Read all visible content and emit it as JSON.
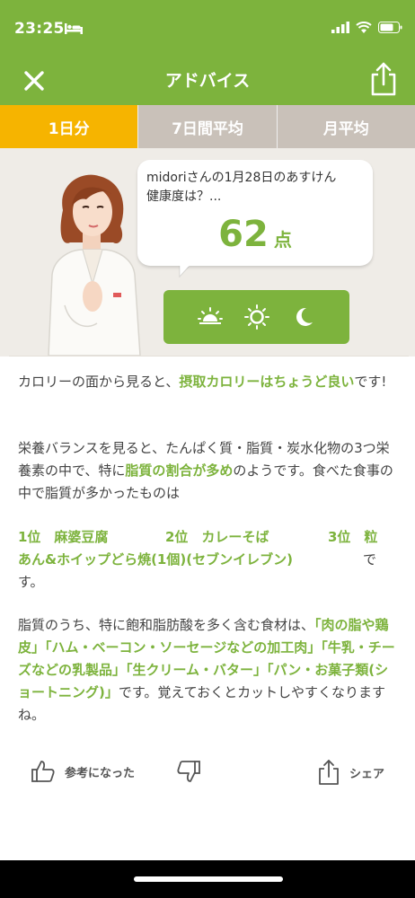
{
  "status": {
    "time": "23:25"
  },
  "nav": {
    "title": "アドバイス"
  },
  "tabs": [
    {
      "label": "1日分",
      "active": true
    },
    {
      "label": "7日間平均",
      "active": false
    },
    {
      "label": "月平均",
      "active": false
    }
  ],
  "bubble": {
    "text_line1": "midoriさんの1月28日のあすけん",
    "text_line2": "健康度は？...",
    "score": "62",
    "unit": "点"
  },
  "message": {
    "p1_a": "カロリーの面から見ると、",
    "p1_hl": "摂取カロリーはちょうど良い",
    "p1_b": "です!",
    "p2_a": "栄養バランスを見ると、たんぱく質・脂質・炭水化物の3つ栄養素の中で、特に",
    "p2_hl": "脂質の割合が多め",
    "p2_b": "のようです。食べた食事の中で脂質が多かったものは",
    "rank1": "1位　麻婆豆腐",
    "rank2": "2位　カレーそば",
    "rank3": "3位　粒",
    "rank_cont": "あん&ホイップどら焼(1個)(セブンイレブン)",
    "rank_tail_a": "で",
    "rank_tail_b": "す。",
    "p4_a": "脂質のうち、特に飽和脂肪酸を多く含む食材は、",
    "p4_hl": "「肉の脂や鶏皮」「ハム・ベーコン・ソーセージなどの加工肉」「牛乳・チーズなどの乳製品」「生クリーム・バター」「パン・お菓子類(ショートニング)」",
    "p4_b": "です。覚えておくとカットしやすくなりますね。"
  },
  "actions": {
    "helpful": "参考になった",
    "share": "シェア"
  },
  "colors": {
    "brand_green": "#7db33d",
    "tab_active": "#f6b400",
    "tab_inactive": "#c9c1b9",
    "hero_bg": "#efece7"
  },
  "icons": [
    "close-icon",
    "share-icon",
    "sunrise-icon",
    "sun-icon",
    "moon-icon",
    "thumbs-up-icon",
    "thumbs-down-icon"
  ]
}
